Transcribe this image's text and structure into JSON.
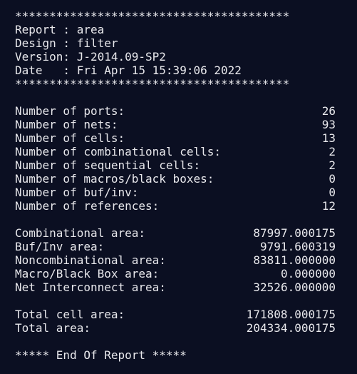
{
  "header": {
    "stars_top": "****************************************",
    "report": "Report : area",
    "design": "Design : filter",
    "version": "Version: J-2014.09-SP2",
    "date": "Date   : Fri Apr 15 15:39:06 2022",
    "stars_bottom": "****************************************"
  },
  "counts": [
    {
      "label": "Number of ports:",
      "value": "26"
    },
    {
      "label": "Number of nets:",
      "value": "93"
    },
    {
      "label": "Number of cells:",
      "value": "13"
    },
    {
      "label": "Number of combinational cells:",
      "value": "2"
    },
    {
      "label": "Number of sequential cells:",
      "value": "2"
    },
    {
      "label": "Number of macros/black boxes:",
      "value": "0"
    },
    {
      "label": "Number of buf/inv:",
      "value": "0"
    },
    {
      "label": "Number of references:",
      "value": "12"
    }
  ],
  "areas": [
    {
      "label": "Combinational area:",
      "value": "87997.000175"
    },
    {
      "label": "Buf/Inv area:",
      "value": "9791.600319"
    },
    {
      "label": "Noncombinational area:",
      "value": "83811.000000"
    },
    {
      "label": "Macro/Black Box area:",
      "value": "0.000000"
    },
    {
      "label": "Net Interconnect area:",
      "value": "32526.000000"
    }
  ],
  "totals": [
    {
      "label": "Total cell area:",
      "value": "171808.000175"
    },
    {
      "label": "Total area:",
      "value": "204334.000175"
    }
  ],
  "footer": "***** End Of Report *****"
}
